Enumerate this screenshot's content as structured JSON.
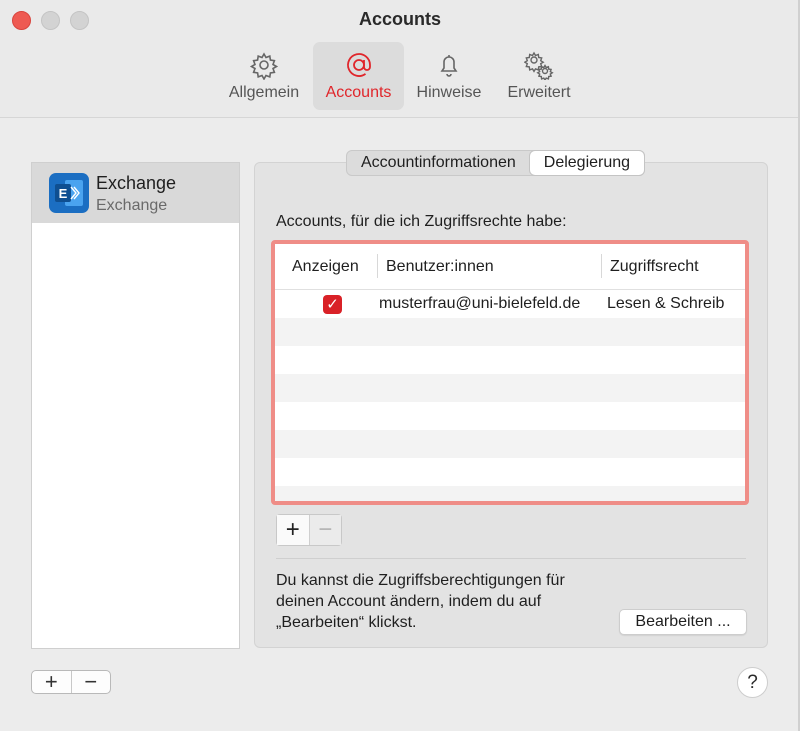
{
  "window": {
    "title": "Accounts"
  },
  "toolbar": {
    "items": [
      {
        "label": "Allgemein",
        "icon": "gear-icon",
        "active": false
      },
      {
        "label": "Accounts",
        "icon": "at-sign-icon",
        "active": true
      },
      {
        "label": "Hinweise",
        "icon": "bell-icon",
        "active": false
      },
      {
        "label": "Erweitert",
        "icon": "gears-icon",
        "active": false
      }
    ]
  },
  "sidebar": {
    "accounts": [
      {
        "name": "Exchange",
        "type": "Exchange",
        "icon": "exchange-icon",
        "selected": true
      }
    ]
  },
  "tabs": {
    "items": [
      "Accountinformationen",
      "Delegierung"
    ],
    "selected": "Delegierung"
  },
  "delegation": {
    "heading": "Accounts, für die ich Zugriffsrechte habe:",
    "columns": [
      "Anzeigen",
      "Benutzer:innen",
      "Zugriffsrecht"
    ],
    "rows": [
      {
        "show": true,
        "user": "musterfrau@uni-bielefeld.de",
        "access": "Lesen & Schreib"
      }
    ],
    "info_text": "Du kannst die Zugriffsberechtigungen für deinen Account ändern, indem du auf „Bearbeiten“ klickst.",
    "edit_label": "Bearbeiten ..."
  },
  "help_label": "?",
  "colors": {
    "accent": "#e0262b",
    "highlight_border": "#ef8d87",
    "checkbox": "#d92127"
  }
}
